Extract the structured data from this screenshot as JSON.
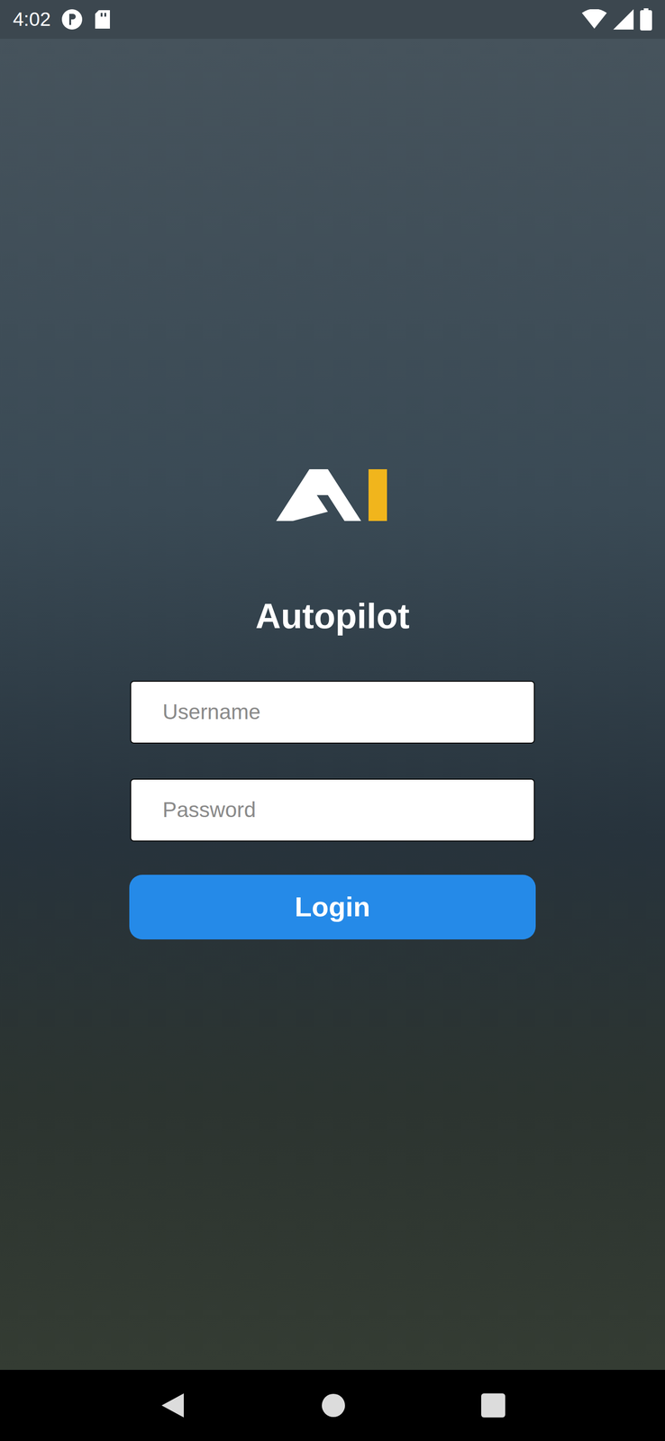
{
  "status_bar": {
    "time": "4:02"
  },
  "app": {
    "title": "Autopilot"
  },
  "form": {
    "username": {
      "placeholder": "Username"
    },
    "password": {
      "placeholder": "Password"
    },
    "login_button": "Login"
  }
}
